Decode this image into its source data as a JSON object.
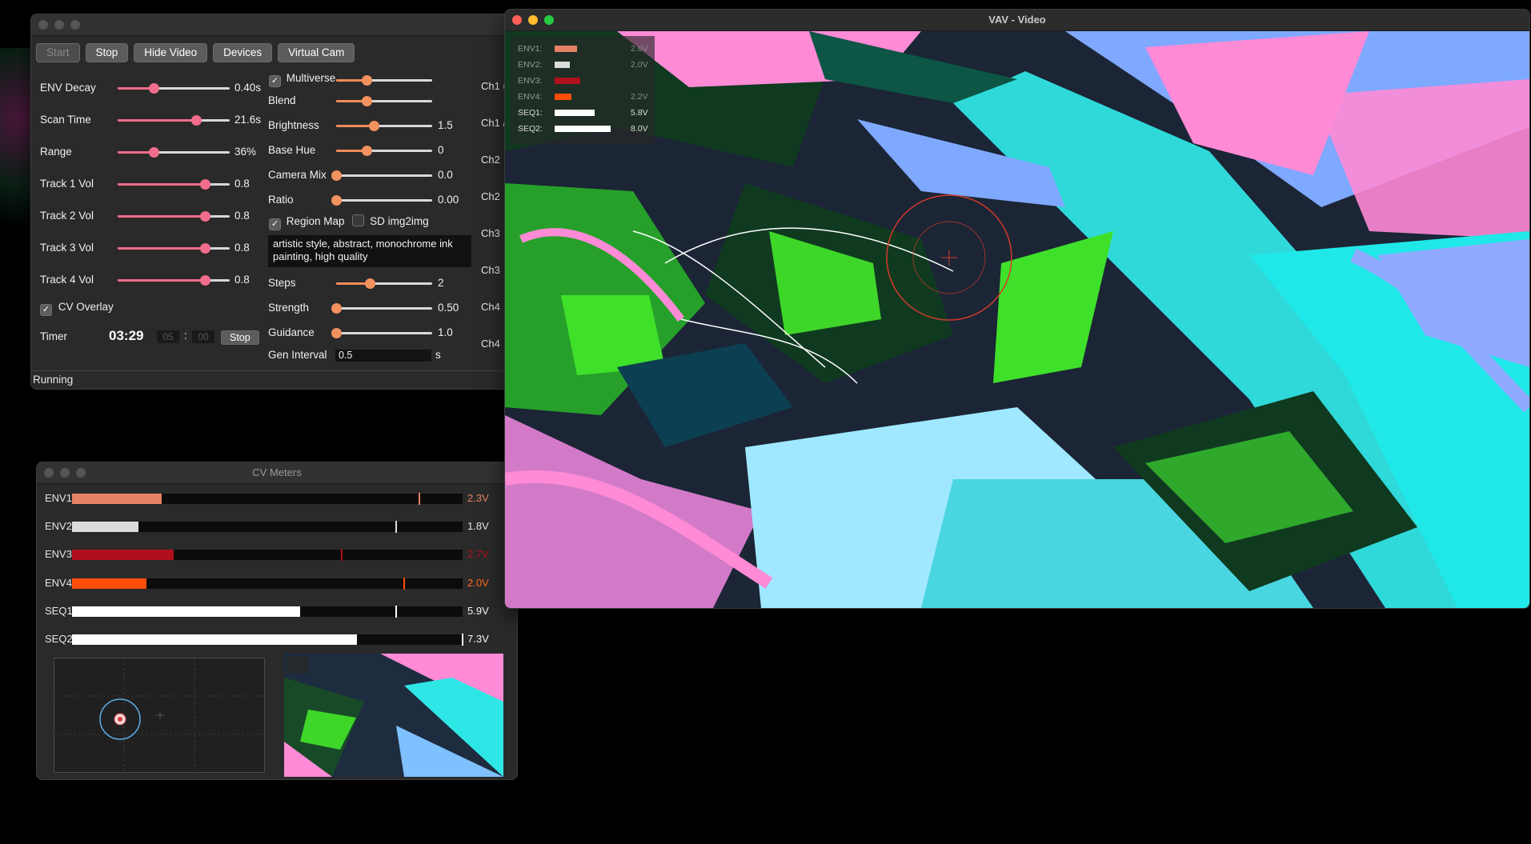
{
  "controls": {
    "toolbar": [
      "Start",
      "Stop",
      "Hide Video",
      "Devices",
      "Virtual Cam"
    ],
    "left_sliders": [
      {
        "label": "ENV Decay",
        "value": "0.40s",
        "level": 0.32
      },
      {
        "label": "Scan Time",
        "value": "21.6s",
        "level": 0.7
      },
      {
        "label": "Range",
        "value": "36%",
        "level": 0.32
      },
      {
        "label": "Track 1 Vol",
        "value": "0.8",
        "level": 0.78
      },
      {
        "label": "Track 2 Vol",
        "value": "0.8",
        "level": 0.78
      },
      {
        "label": "Track 3 Vol",
        "value": "0.8",
        "level": 0.78
      },
      {
        "label": "Track 4 Vol",
        "value": "0.8",
        "level": 0.78
      }
    ],
    "cv_overlay_label": "CV Overlay",
    "timer": {
      "label": "Timer",
      "display": "03:29",
      "min": "05",
      "sec": "00",
      "sep": ":",
      "button": "Stop"
    },
    "multiverse_label": "Multiverse",
    "right_sliders": [
      {
        "label": "Blend",
        "value": "",
        "level": 0.32
      },
      {
        "label": "Brightness",
        "value": "1.5",
        "level": 0.39
      },
      {
        "label": "Base Hue",
        "value": "0",
        "level": 0.32
      },
      {
        "label": "Camera Mix",
        "value": "0.0",
        "level": 0.0
      },
      {
        "label": "Ratio",
        "value": "0.00",
        "level": 0.0
      }
    ],
    "multiverse_level": 0.32,
    "region_map_label": "Region Map",
    "sd_label": "SD img2img",
    "prompt": "artistic style, abstract, monochrome ink painting, high quality",
    "sd_sliders": [
      {
        "label": "Steps",
        "value": "2",
        "level": 0.35
      },
      {
        "label": "Strength",
        "value": "0.50",
        "level": 0.0
      },
      {
        "label": "Guidance",
        "value": "1.0",
        "level": 0.0
      }
    ],
    "gen_interval": {
      "label": "Gen Interval",
      "value": "0.5",
      "unit": "s"
    },
    "channels": [
      "Ch1 (",
      "Ch1 /",
      "Ch2",
      "Ch2",
      "Ch3",
      "Ch3",
      "Ch4",
      "Ch4"
    ],
    "status": "Running"
  },
  "meters": {
    "title": "CV Meters",
    "rows": [
      {
        "label": "ENV1",
        "value": "2.3V",
        "level": 0.23,
        "peak": 0.89,
        "color": "#e58266",
        "value_color": "#e58266"
      },
      {
        "label": "ENV2",
        "value": "1.8V",
        "level": 0.17,
        "peak": 0.83,
        "color": "#dcdcdc",
        "value_color": "#e6e6e6"
      },
      {
        "label": "ENV3",
        "value": "2.7V",
        "level": 0.26,
        "peak": 0.69,
        "color": "#b0101c",
        "value_color": "#b0101c"
      },
      {
        "label": "ENV4",
        "value": "2.0V",
        "level": 0.19,
        "peak": 0.85,
        "color": "#ff4d0a",
        "value_color": "#ff6a1a"
      },
      {
        "label": "SEQ1",
        "value": "5.9V",
        "level": 0.585,
        "peak": 0.83,
        "color": "#ffffff",
        "value_color": "#f5f5f5"
      },
      {
        "label": "SEQ2",
        "value": "7.3V",
        "level": 0.73,
        "peak": 1.0,
        "color": "#ffffff",
        "value_color": "#f5f5f5"
      }
    ]
  },
  "video": {
    "title": "VAV - Video",
    "overlay": [
      {
        "label": "ENV1:",
        "value": "2.6V",
        "level": 0.4,
        "color": "#e58266"
      },
      {
        "label": "ENV2:",
        "value": "2.0V",
        "level": 0.27,
        "color": "#dcdcdc"
      },
      {
        "label": "ENV3:",
        "value": "",
        "level": 0.45,
        "color": "#b0101c"
      },
      {
        "label": "ENV4:",
        "value": "2.2V",
        "level": 0.3,
        "color": "#ff4d0a"
      },
      {
        "label": "SEQ1:",
        "value": "5.8V",
        "level": 0.72,
        "color": "#ffffff"
      },
      {
        "label": "SEQ2:",
        "value": "8.0V",
        "level": 1.0,
        "color": "#ffffff"
      }
    ]
  },
  "icons": {
    "close": "close-dot-icon",
    "minimize": "minimize-dot-icon",
    "zoom": "zoom-dot-icon",
    "check": "checkmark-icon",
    "crosshair": "crosshair-icon"
  }
}
